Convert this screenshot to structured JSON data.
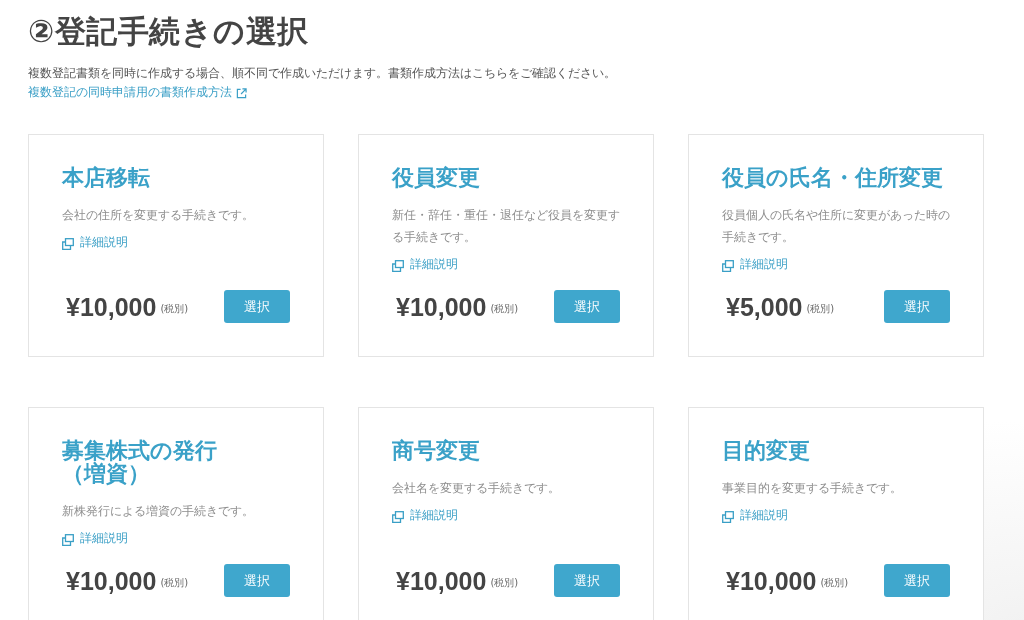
{
  "page": {
    "title": "②登記手続きの選択",
    "intro": "複数登記書類を同時に作成する場合、順不同で作成いただけます。書類作成方法はこちらをご確認ください。",
    "guide_link": "複数登記の同時申請用の書類作成方法"
  },
  "procedures": [
    {
      "title": "本店移転",
      "description": "会社の住所を変更する手続きです。",
      "detail_link": "詳細説明",
      "price": "¥10,000",
      "tax_note": "(税別)",
      "button": "選択"
    },
    {
      "title": "役員変更",
      "description": "新任・辞任・重任・退任など役員を変更する手続きです。",
      "detail_link": "詳細説明",
      "price": "¥10,000",
      "tax_note": "(税別)",
      "button": "選択"
    },
    {
      "title": "役員の氏名・住所変更",
      "description": "役員個人の氏名や住所に変更があった時の手続きです。",
      "detail_link": "詳細説明",
      "price": "¥5,000",
      "tax_note": "(税別)",
      "button": "選択"
    },
    {
      "title": "募集株式の発行（増資）",
      "description": "新株発行による増資の手続きです。",
      "detail_link": "詳細説明",
      "price": "¥10,000",
      "tax_note": "(税別)",
      "button": "選択"
    },
    {
      "title": "商号変更",
      "description": "会社名を変更する手続きです。",
      "detail_link": "詳細説明",
      "price": "¥10,000",
      "tax_note": "(税別)",
      "button": "選択"
    },
    {
      "title": "目的変更",
      "description": "事業目的を変更する手続きです。",
      "detail_link": "詳細説明",
      "price": "¥10,000",
      "tax_note": "(税別)",
      "button": "選択"
    }
  ]
}
